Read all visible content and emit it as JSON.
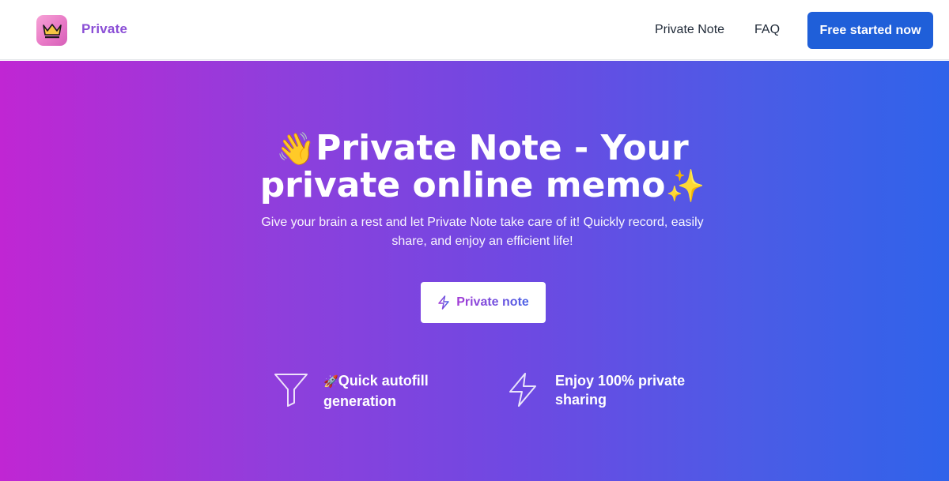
{
  "header": {
    "brand": "Private",
    "nav": [
      {
        "label": "Private Note"
      },
      {
        "label": "FAQ"
      }
    ],
    "cta_label": "Free started now"
  },
  "hero": {
    "title_line1": "Private Note - Your",
    "title_line2": "private online memo",
    "subtitle": "Give your brain a rest and let Private Note take care of it! Quickly record, easily share, and enjoy an efficient life!",
    "button_label": "Private note",
    "features": [
      {
        "icon": "funnel-icon",
        "text": "Quick autofill generation"
      },
      {
        "icon": "lightning-icon",
        "text": "Enjoy 100% private sharing"
      }
    ]
  },
  "colors": {
    "cta": "#1f5fd9",
    "brand_text": "#8b4fd6",
    "hero_gradient_start": "#c026d3",
    "hero_gradient_end": "#2f63ea"
  }
}
